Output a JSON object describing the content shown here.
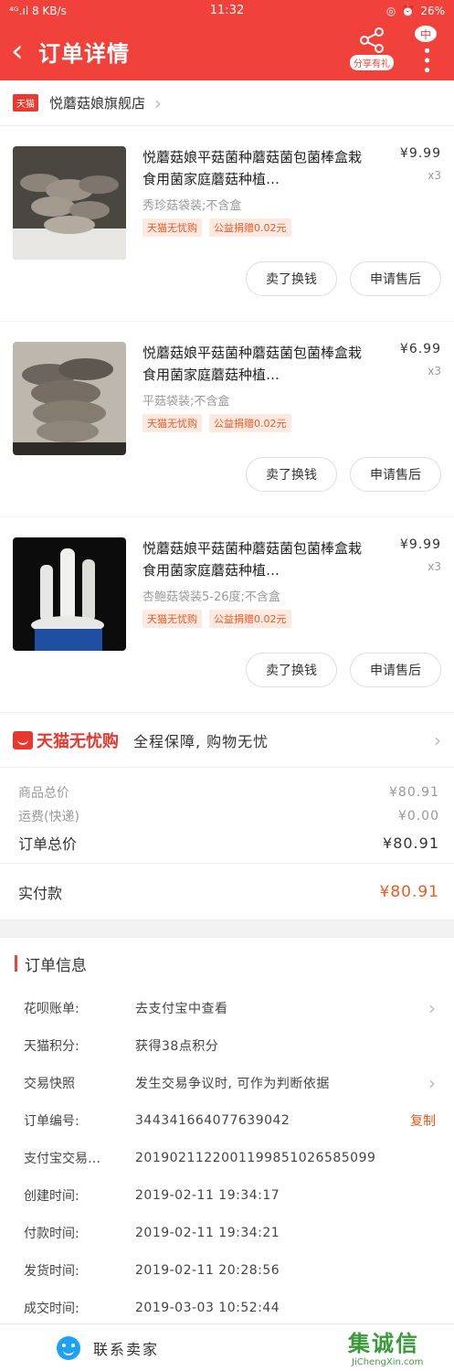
{
  "status_bar": {
    "signal": "⁴ᴳ.ıl",
    "net_speed": "8 KB/s",
    "time": "11:32",
    "battery": "26%"
  },
  "header": {
    "title": "订单详情",
    "share_label": "分享有礼",
    "more_badge": "中"
  },
  "shop": {
    "badge": "天猫",
    "name": "悦蘑菇娘旗舰店"
  },
  "items": [
    {
      "title": "悦蘑菇娘平菇菌种蘑菇菌包菌棒盒栽食用菌家庭蘑菇种植…",
      "price": "¥9.99",
      "qty": "x3",
      "spec": "秀珍菇袋装;不含盒",
      "tags": [
        "天猫无忧购",
        "公益捐赠0.02元"
      ],
      "buttons": [
        "卖了换钱",
        "申请售后"
      ]
    },
    {
      "title": "悦蘑菇娘平菇菌种蘑菇菌包菌棒盒栽食用菌家庭蘑菇种植…",
      "price": "¥6.99",
      "qty": "x3",
      "spec": "平菇袋装;不含盒",
      "tags": [
        "天猫无忧购",
        "公益捐赠0.02元"
      ],
      "buttons": [
        "卖了换钱",
        "申请售后"
      ]
    },
    {
      "title": "悦蘑菇娘平菇菌种蘑菇菌包菌棒盒栽食用菌家庭蘑菇种植…",
      "price": "¥9.99",
      "qty": "x3",
      "spec": "杏鲍菇袋装5-26度;不含盒",
      "tags": [
        "天猫无忧购",
        "公益捐赠0.02元"
      ],
      "buttons": [
        "卖了换钱",
        "申请售后"
      ]
    }
  ],
  "guarantee": {
    "logo": "天猫无忧购",
    "text": "全程保障, 购物无忧"
  },
  "summary": {
    "goods_label": "商品总价",
    "goods_value": "¥80.91",
    "shipping_label": "运费(快递)",
    "shipping_value": "¥0.00",
    "total_label": "订单总价",
    "total_value": "¥80.91",
    "paid_label": "实付款",
    "paid_value": "¥80.91"
  },
  "order_info": {
    "title": "订单信息",
    "rows": [
      {
        "key": "花呗账单:",
        "value": "去支付宝中查看",
        "arrow": true
      },
      {
        "key": "天猫积分:",
        "value": "获得38点积分"
      },
      {
        "key": "交易快照",
        "value": "发生交易争议时, 可作为判断依据",
        "arrow": true
      },
      {
        "key": "订单编号:",
        "value": "344341664077639042",
        "action": "复制"
      },
      {
        "key": "支付宝交易…",
        "value": "2019021122001199851026585099"
      },
      {
        "key": "创建时间:",
        "value": "2019-02-11 19:34:17"
      },
      {
        "key": "付款时间:",
        "value": "2019-02-11 19:34:21"
      },
      {
        "key": "发货时间:",
        "value": "2019-02-11 20:28:56"
      },
      {
        "key": "成交时间:",
        "value": "2019-03-03 10:52:44"
      }
    ]
  },
  "bottom": {
    "contact_label": "联系卖家",
    "watermark_text": "集诚信",
    "watermark_url": "JiChengXin.com"
  },
  "colors": {
    "brand_red": "#f0413a",
    "price_orange": "#f05a1e",
    "tag_bg": "#fde9df"
  }
}
